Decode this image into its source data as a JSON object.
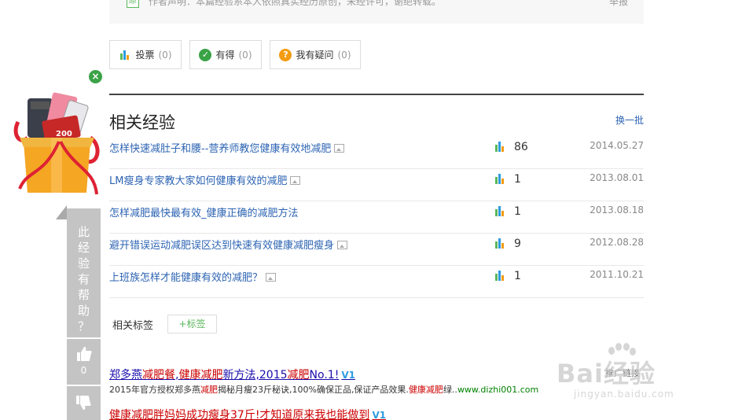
{
  "statement": {
    "icon_label": "原",
    "text": "作者声明：本篇经验系本人依照真实经历原创，未经许可，谢绝转载。",
    "report": "举报"
  },
  "actions": [
    {
      "label": "投票",
      "count": "(0)"
    },
    {
      "label": "有得",
      "count": "(0)"
    },
    {
      "label": "我有疑问",
      "count": "(0)"
    }
  ],
  "gift_box": {
    "badge": "200"
  },
  "helpful_bar": {
    "chars": [
      "此",
      "经",
      "验",
      "有",
      "帮",
      "助",
      "？"
    ],
    "like_count": "0"
  },
  "related": {
    "title": "相关经验",
    "refresh": "换一批",
    "items": [
      {
        "title": "怎样快速减肚子和腰--营养师教您健康有效地减肥",
        "count": "86",
        "date": "2014.05.27"
      },
      {
        "title": "LM瘦身专家教大家如何健康有效的减肥",
        "count": "1",
        "date": "2013.08.01"
      },
      {
        "title": "怎样减肥最快最有效_健康正确的减肥方法",
        "count": "1",
        "date": "2013.08.18"
      },
      {
        "title": "避开错误运动减肥误区达到快速有效健康减肥瘦身",
        "count": "9",
        "date": "2012.08.28"
      },
      {
        "title": "上班族怎样才能健康有效的减肥？",
        "count": "1",
        "date": "2011.10.21"
      }
    ]
  },
  "tags": {
    "label": "相关标签",
    "add_button": "+标签"
  },
  "ads": {
    "ad1": {
      "p1": "郑多燕",
      "h1": "减肥餐",
      "p2": ",",
      "h2": "健康减肥",
      "p3": "新方法,2015",
      "h3": "减肥",
      "p4": "No.1!",
      "badge": "V1"
    },
    "ad1_desc": {
      "p1": "2015年官方授权郑多燕",
      "h1": "减肥",
      "p2": "揭秘月瘦23斤秘诀,100%确保正品,保证产品效果.",
      "h2": "健康减肥",
      "p3": "绿..",
      "url": "www.dizhi001.com"
    },
    "ad_mark": "推广链接",
    "ad2": {
      "title": "健康减肥胖妈妈成功瘦身37斤!才知道原来我也能做到",
      "badge": "V1"
    }
  },
  "watermark": {
    "brand": "Bai经验",
    "url": "jingyan.baidu.com"
  },
  "colors": {
    "link": "#2d64b3",
    "green": "#5bb75b",
    "ad_red": "#c00",
    "bar_grey": "#c4c4c4"
  }
}
